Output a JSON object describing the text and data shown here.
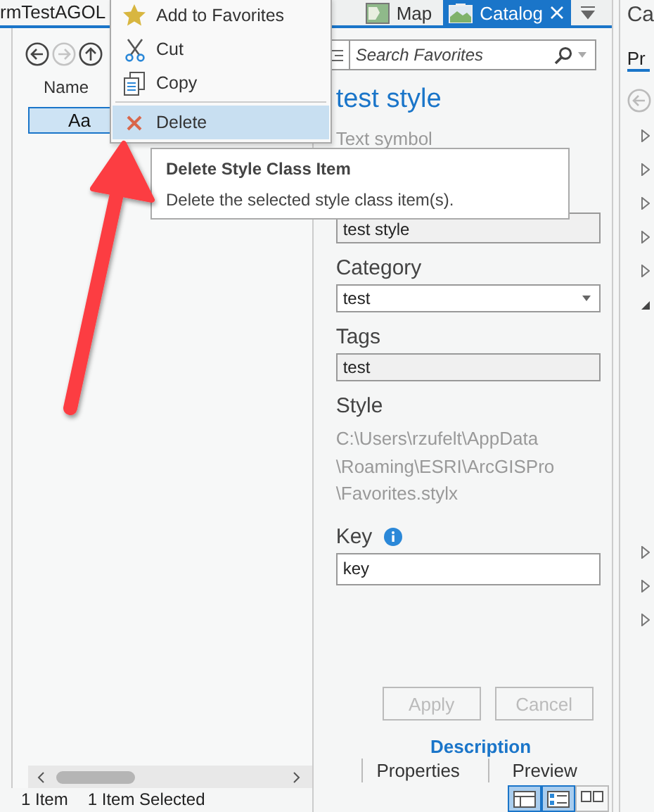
{
  "left_pane": {
    "tab_title": "rmTestAGOL",
    "nav_buttons": [
      {
        "kind": "back",
        "disabled": false
      },
      {
        "kind": "forward",
        "disabled": true
      },
      {
        "kind": "up",
        "disabled": false
      }
    ],
    "column_header": "Name",
    "items": [
      {
        "label": "Aa",
        "selected": true
      }
    ],
    "status": [
      "1 Item",
      "1 Item Selected"
    ]
  },
  "tabs": [
    {
      "label": "Map",
      "kind": "map",
      "selected": false
    },
    {
      "label": "Catalog",
      "kind": "catalog",
      "selected": true
    }
  ],
  "search": {
    "placeholder": "Search Favorites"
  },
  "details": {
    "title": "test style",
    "subtitle": "Text symbol",
    "name_value": "test style",
    "category": {
      "label": "Category",
      "value": "test"
    },
    "tags": {
      "label": "Tags",
      "value": "test"
    },
    "style": {
      "label": "Style",
      "path_lines": [
        "C:\\Users\\rzufelt\\AppData",
        "\\Roaming\\ESRI\\ArcGISPro",
        "\\Favorites.stylx"
      ]
    },
    "key": {
      "label": "Key",
      "value": "key"
    },
    "buttons": [
      {
        "label": "Apply",
        "disabled": true
      },
      {
        "label": "Cancel",
        "disabled": true
      }
    ],
    "view_tabs": [
      {
        "label": "Description",
        "selected": true
      },
      {
        "label": "Properties",
        "selected": false
      },
      {
        "label": "Preview",
        "selected": false
      }
    ],
    "layout_buttons": [
      {
        "kind": "table",
        "selected": true
      },
      {
        "kind": "details",
        "selected": true
      },
      {
        "kind": "tiles",
        "selected": false
      }
    ]
  },
  "right_pane": {
    "title": "Ca",
    "tab": "Pr",
    "tree_toggles": [
      {
        "expanded": false
      },
      {
        "expanded": false
      },
      {
        "expanded": false
      },
      {
        "expanded": false
      },
      {
        "expanded": false
      },
      {
        "expanded": true
      },
      {
        "expanded": false
      },
      {
        "expanded": false
      },
      {
        "expanded": false
      }
    ]
  },
  "context_menu": {
    "items": [
      {
        "label": "Add to Favorites",
        "kind": "favorite",
        "selected": false
      },
      {
        "label": "Cut",
        "kind": "cut",
        "selected": false
      },
      {
        "label": "Copy",
        "kind": "copy",
        "selected": false
      },
      {
        "label": "Delete",
        "kind": "delete",
        "selected": true
      }
    ]
  },
  "tooltip": {
    "title": "Delete Style Class Item",
    "text": "Delete the selected style class item(s)."
  }
}
